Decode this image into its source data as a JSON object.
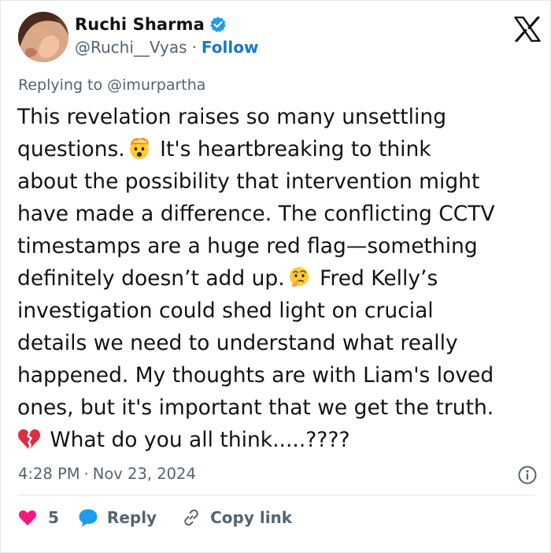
{
  "user": {
    "display_name": "Ruchi Sharma",
    "handle": "@Ruchi__Vyas",
    "separator": "·",
    "follow_label": "Follow"
  },
  "replying_to": "Replying to @imurpartha",
  "tweet": {
    "lines": [
      "This revelation raises so many unsettling",
      "questions.",
      " It's heartbreaking to think",
      "about the possibility that intervention might",
      "have made a difference. The conflicting CCTV",
      "timestamps are a huge red flag—something",
      "definitely doesn’t add up.",
      " Fred Kelly’s",
      "investigation could shed light on crucial",
      "details we need to understand what really",
      "happened. My thoughts are with Liam's loved",
      "ones, but it's important that we get the truth.",
      " What do you all think.....????"
    ]
  },
  "emojis": {
    "exploding_head": "exploding-head-emoji",
    "thinking": "thinking-face-emoji",
    "broken_heart": "broken-heart-emoji"
  },
  "meta": {
    "time": "4:28 PM",
    "separator": "·",
    "date": "Nov 23, 2024"
  },
  "actions": {
    "like_count": "5",
    "reply_label": "Reply",
    "copy_label": "Copy link"
  },
  "colors": {
    "link": "#1d77c4",
    "secondary_text": "#536471",
    "like": "#f91880",
    "reply": "#1d9bf0",
    "verified": "#1d9bf0"
  }
}
